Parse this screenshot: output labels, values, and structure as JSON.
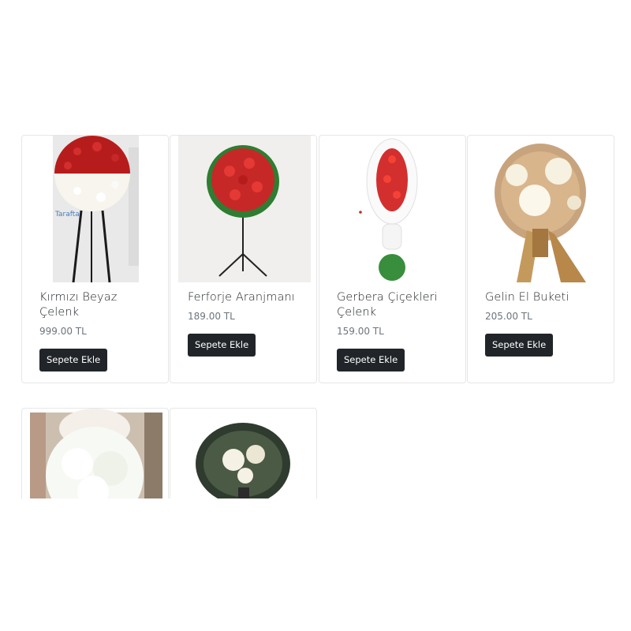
{
  "products": [
    {
      "name": "Kırmızı Beyaz Çelenk",
      "price": "999.00 TL",
      "button": "Sepete Ekle",
      "image_icon": "red-white-wreath-image"
    },
    {
      "name": "Ferforje Aranjmanı",
      "price": "189.00 TL",
      "button": "Sepete Ekle",
      "image_icon": "iron-stand-arrangement-image"
    },
    {
      "name": "Gerbera Çiçekleri Çelenk",
      "price": "159.00 TL",
      "button": "Sepete Ekle",
      "image_icon": "gerbera-wreath-image"
    },
    {
      "name": "Gelin El Buketi",
      "price": "205.00 TL",
      "button": "Sepete Ekle",
      "image_icon": "bridal-bouquet-image"
    },
    {
      "image_icon": "white-hydrangea-bouquet-image"
    },
    {
      "image_icon": "white-lily-bouquet-image"
    }
  ]
}
